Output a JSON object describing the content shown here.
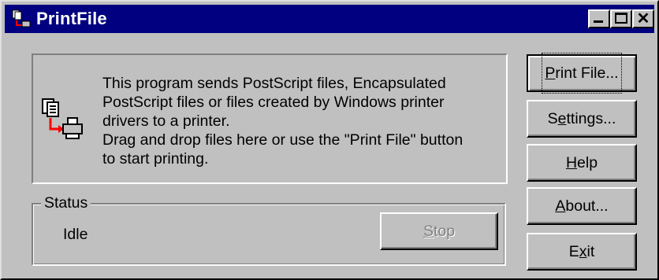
{
  "window": {
    "title": "PrintFile",
    "controls": {
      "minimize": "minimize",
      "maximize": "maximize",
      "close": "close"
    },
    "colors": {
      "title_bg": "#000080",
      "face": "#c0c0c0"
    }
  },
  "info": {
    "lines": [
      "This program sends PostScript files, Encapsulated",
      "PostScript files or files created by Windows printer",
      "drivers to a printer.",
      "Drag and drop files here or use the \"Print File\" button",
      "to start printing."
    ],
    "icon": "document-to-printer-icon"
  },
  "status": {
    "label": "Status",
    "value": "Idle",
    "stop": {
      "pre": "",
      "accel": "S",
      "post": "top",
      "enabled": false
    }
  },
  "buttons": {
    "print": {
      "pre": "",
      "accel": "P",
      "post": "rint File..."
    },
    "settings": {
      "pre": "S",
      "accel": "e",
      "post": "ttings..."
    },
    "help": {
      "pre": "",
      "accel": "H",
      "post": "elp"
    },
    "about": {
      "pre": "",
      "accel": "A",
      "post": "bout..."
    },
    "exit": {
      "pre": "E",
      "accel": "x",
      "post": "it"
    }
  }
}
